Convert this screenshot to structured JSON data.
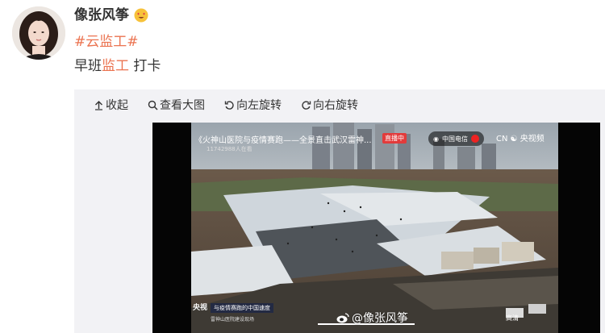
{
  "post": {
    "username": "像张风筝",
    "emoji_icon": "heart-eyes-emoji-icon",
    "topic": "#云监工#",
    "content_prefix": "早班",
    "content_highlight": "监工",
    "content_suffix": " 打卡"
  },
  "toolbar": {
    "collapse_label": "收起",
    "view_large_label": "查看大图",
    "rotate_left_label": "向左旋转",
    "rotate_right_label": "向右旋转"
  },
  "video": {
    "title": "《火神山医院与疫情赛跑——全景直击武汉雷神...",
    "live_badge": "直播中",
    "viewers": "11742988人在看",
    "brand": "中国电信",
    "logos": "CN ☯ 央视频",
    "bottom_logo": "央视",
    "tag": "与疫情赛跑的中国速度",
    "sub": "雷神山医院建设现场",
    "quality": "高清",
    "watermark": "@像张风筝"
  },
  "colors": {
    "accent": "#eb7350",
    "media_bg": "#f2f2f5",
    "live": "#e23b3b"
  }
}
